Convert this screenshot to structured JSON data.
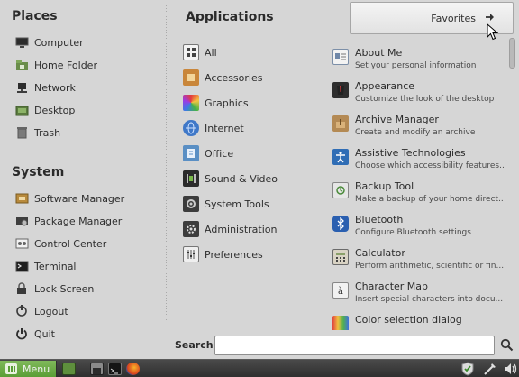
{
  "places": {
    "title": "Places",
    "items": [
      {
        "label": "Computer",
        "icon": "computer-icon"
      },
      {
        "label": "Home Folder",
        "icon": "home-folder-icon"
      },
      {
        "label": "Network",
        "icon": "network-icon"
      },
      {
        "label": "Desktop",
        "icon": "desktop-icon"
      },
      {
        "label": "Trash",
        "icon": "trash-icon"
      }
    ]
  },
  "system": {
    "title": "System",
    "items": [
      {
        "label": "Software Manager",
        "icon": "software-manager-icon"
      },
      {
        "label": "Package Manager",
        "icon": "package-manager-icon"
      },
      {
        "label": "Control Center",
        "icon": "control-center-icon"
      },
      {
        "label": "Terminal",
        "icon": "terminal-icon"
      },
      {
        "label": "Lock Screen",
        "icon": "lock-icon"
      },
      {
        "label": "Logout",
        "icon": "logout-icon"
      },
      {
        "label": "Quit",
        "icon": "power-icon"
      }
    ]
  },
  "applications": {
    "title": "Applications",
    "categories": [
      {
        "label": "All",
        "icon": "all-icon"
      },
      {
        "label": "Accessories",
        "icon": "accessories-icon"
      },
      {
        "label": "Graphics",
        "icon": "graphics-icon"
      },
      {
        "label": "Internet",
        "icon": "internet-icon"
      },
      {
        "label": "Office",
        "icon": "office-icon"
      },
      {
        "label": "Sound & Video",
        "icon": "sound-video-icon"
      },
      {
        "label": "System Tools",
        "icon": "system-tools-icon"
      },
      {
        "label": "Administration",
        "icon": "administration-icon"
      },
      {
        "label": "Preferences",
        "icon": "preferences-icon"
      }
    ],
    "apps": [
      {
        "name": "About Me",
        "desc": "Set your personal information",
        "icon": "about-me-icon"
      },
      {
        "name": "Appearance",
        "desc": "Customize the look of the desktop",
        "icon": "appearance-icon"
      },
      {
        "name": "Archive Manager",
        "desc": "Create and modify an archive",
        "icon": "archive-manager-icon"
      },
      {
        "name": "Assistive Technologies",
        "desc": "Choose which accessibility features...",
        "icon": "accessibility-icon"
      },
      {
        "name": "Backup Tool",
        "desc": "Make a backup of your home direct...",
        "icon": "backup-tool-icon"
      },
      {
        "name": "Bluetooth",
        "desc": "Configure Bluetooth settings",
        "icon": "bluetooth-icon"
      },
      {
        "name": "Calculator",
        "desc": "Perform arithmetic, scientific or fin...",
        "icon": "calculator-icon"
      },
      {
        "name": "Character Map",
        "desc": "Insert special characters into docu...",
        "icon": "character-map-icon"
      },
      {
        "name": "Color selection dialog",
        "desc": "",
        "icon": "color-selection-icon"
      }
    ]
  },
  "favorites": {
    "label": "Favorites",
    "arrow_icon": "arrow-right-icon"
  },
  "search": {
    "label": "Search:",
    "value": "",
    "placeholder": ""
  },
  "taskbar": {
    "menu_label": "Menu",
    "launchers": [
      "show-desktop-icon",
      "window-list-icon",
      "terminal-icon",
      "firefox-icon"
    ],
    "tray": [
      "shield-check-icon",
      "network-tool-icon",
      "volume-icon"
    ]
  },
  "colors": {
    "menu_bg": "#d6d6d6",
    "accent_green": "#6aa845",
    "taskbar_bg": "#3a3a3a"
  }
}
